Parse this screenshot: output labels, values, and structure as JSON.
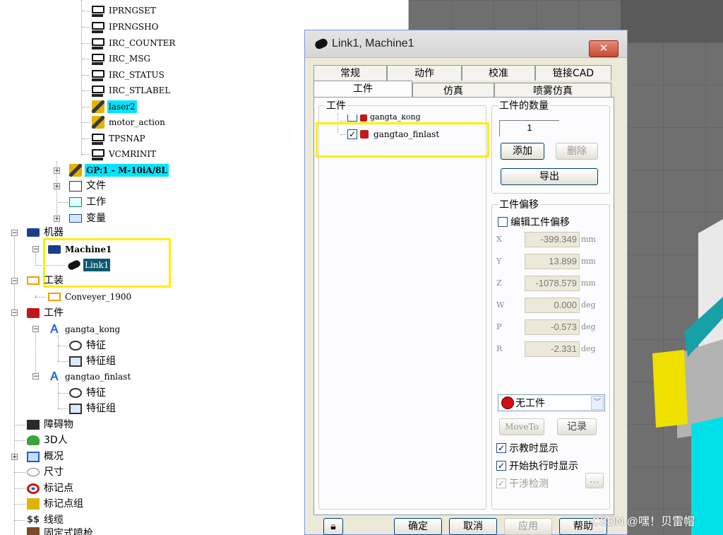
{
  "tree": {
    "programs": [
      "IPRNGSET",
      "IPRNGSHO",
      "IRC_COUNTER",
      "IRC_MSG",
      "IRC_STATUS",
      "IRC_STLABEL",
      "laser2",
      "motor_action",
      "TPSNAP",
      "VCMRINIT"
    ],
    "gp": "GP:1 - M-10iA/8L",
    "files": "文件",
    "work": "工作",
    "vars": "变量",
    "machines": "机器",
    "machine1": "Machine1",
    "link1": "Link1",
    "fixtures": "工装",
    "conveyer": "Conveyer_1900",
    "parts": "工件",
    "part1": "gangta_kong",
    "part2": "gangtao_finlast",
    "feature": "特征",
    "feature_group": "特征组",
    "obstacle": "障碍物",
    "human3d": "3D人",
    "overview": "概况",
    "dimension": "尺寸",
    "target": "标记点",
    "target_group": "标记点组",
    "cable": "线缆",
    "spray": "固定式喷枪"
  },
  "dialog": {
    "title": "Link1, Machine1",
    "close": "✕",
    "tabs_row1": [
      "常规",
      "动作",
      "校准",
      "链接CAD"
    ],
    "tabs_row2": [
      "工件",
      "仿真",
      "喷雾仿真"
    ],
    "parts_group": "工件",
    "part_list": [
      "gangta_kong",
      "gangtao_finlast"
    ],
    "qty_group": "工件的数量",
    "qty_value": "1",
    "add": "添加",
    "delete": "删除",
    "export": "导出",
    "offset_group": "工件偏移",
    "edit_offset": "编辑工件偏移",
    "offsets": [
      {
        "label": "X",
        "value": "-399.349",
        "unit": "mm"
      },
      {
        "label": "Y",
        "value": "13.899",
        "unit": "mm"
      },
      {
        "label": "Z",
        "value": "-1078.579",
        "unit": "mm"
      },
      {
        "label": "W",
        "value": "0.000",
        "unit": "deg"
      },
      {
        "label": "P",
        "value": "-0.573",
        "unit": "deg"
      },
      {
        "label": "R",
        "value": "-2.331",
        "unit": "deg"
      }
    ],
    "no_part": "无工件",
    "moveto": "MoveTo",
    "record": "记录",
    "show_teach": "示教时显示",
    "show_run": "开始执行时显示",
    "interference": "干涉检测",
    "ellipsis": "...",
    "ok": "确定",
    "cancel": "取消",
    "apply": "应用",
    "help": "帮助"
  },
  "watermark": "CSDN @嘿！贝雷帽",
  "colors": {
    "selection": "#00e5ff",
    "highlight": "#ffee00",
    "dark_selection": "#0b5a6e"
  }
}
